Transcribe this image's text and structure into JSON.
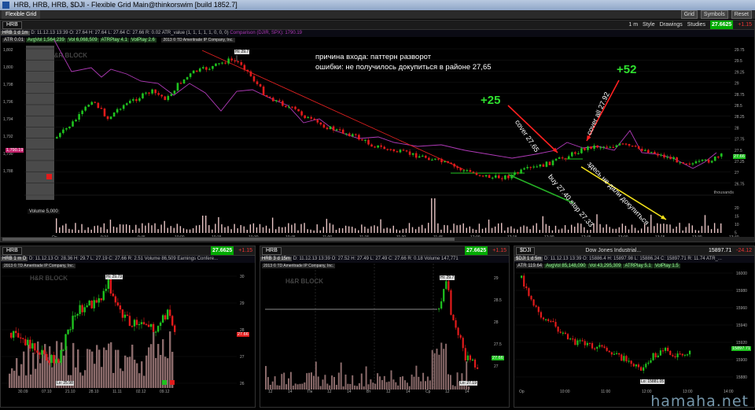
{
  "window": {
    "title": "HRB, HRB, HRB, $DJI - Flexible Grid Main@thinkorswim [build 1852.7]",
    "tab": "Flexible Grid",
    "buttons": [
      "Grid",
      "Symbols",
      "Reset"
    ]
  },
  "main": {
    "symbol": "HRB",
    "price": "27.6625",
    "change": "+1.15",
    "toolbar": [
      "Style",
      "Drawings",
      "Studies"
    ],
    "timeframe": "1 m",
    "info": "D: 11.12.13 13:39  O: 27.64  H: 27.64  L: 27.64  C: 27.66  R: 0.02  ATR_value (1, 1, 1, 1, 1, 0, 0, 0)",
    "info_label": "HRB 1 d 1m",
    "comparison": "Comparison (DJIR, SPX): 1790.19",
    "studies": [
      "ATR 0.01",
      "AvgVol 1,564,239",
      "Vol 6,068,509",
      "ATRPlay 4.1",
      "VolPlay 2.6"
    ],
    "copyright": "2013 © TD Ameritrade IP Company, Inc.",
    "company": "H&R BLOCK",
    "hi_label": "Hi: 29.7",
    "last_tag": "27.66",
    "left_tag": "1,790.19",
    "right_axis": [
      "29.75",
      "29.5",
      "29.25",
      "29",
      "28.75",
      "28.5",
      "28.25",
      "28",
      "27.75",
      "27.5",
      "27.25",
      "27",
      "26.75"
    ],
    "left_axis": [
      "1,802",
      "1,800",
      "1,798",
      "1,796",
      "1,794",
      "1,792",
      "1,790",
      "1,788"
    ],
    "time_axis": [
      "Op",
      "9:34",
      "9:45",
      "10:00",
      "10:15",
      "10:30",
      "10:45",
      "11:00",
      "11:15",
      "11:30",
      "11:45",
      "12:00",
      "12:15",
      "12:30",
      "12:45",
      "13:00",
      "13:15",
      "13:30",
      "13:40"
    ],
    "volume_label": "Volume  5,000",
    "volume_unit": "thousands",
    "volume_axis": [
      "20",
      "15",
      "10",
      "5"
    ],
    "annotation_line1": "причина входа: паттерн разворот",
    "annotation_line2": "ошибки: не получилось докупиться в районе 27,65",
    "plus25": "+25",
    "plus52": "+52",
    "cover1": "cover 27.65",
    "cover2": "cover all 27.92",
    "buy": "buy 27.40 stop 27.33",
    "nodocup": "здесь не дали докупиться"
  },
  "panel1": {
    "symbol": "HRB",
    "price": "27.6625",
    "change": "+1.15",
    "info": "D: 11.12.13  O: 28.36  H: 29.7  L: 27.19  C: 27.66  R: 2.51  Volume 86,509  Earnings Confere...",
    "info_label": "HRB 1 m D",
    "copyright": "2013 © TD Ameritrade IP Company, Inc.",
    "company": "H&R BLOCK",
    "hi_label": "Hi: 29.73",
    "lo_label": "Lo: 25.98",
    "last_tag": "27.66",
    "right_axis": [
      "30",
      "29",
      "28",
      "27",
      "26"
    ],
    "time_axis": [
      "30.09",
      "07.10",
      "21.10",
      "28.10",
      "11.11",
      "02.12",
      "09.12"
    ]
  },
  "panel2": {
    "symbol": "HRB",
    "price": "27.6625",
    "change": "+1.15",
    "info": "D: 11.12.13 13:39  O: 27.52  H: 27.49  L: 27.49  C: 27.66  R: 0.18  Volume 147,771",
    "info_label": "HRB 3 d 15m",
    "copyright": "2013 © TD Ameritrade IP Company, Inc.",
    "company": "H&R BLOCK",
    "hi_label": "Hi: 29.7",
    "lo_label": "Lo: 27.19",
    "last_tag": "27.66",
    "right_axis": [
      "29",
      "28.5",
      "28",
      "27.5",
      "27"
    ],
    "time_axis": [
      "12",
      "14",
      "Пн",
      "12",
      "14",
      "Вт",
      "12",
      "14",
      "Ср",
      "12",
      "14"
    ]
  },
  "panel3": {
    "symbol": "$DJI",
    "price": "15897.71",
    "change": "-24.12",
    "name": "Dow Jones Industrial...",
    "info": "D: 11.12.13 13:39  O: 15886.4  H: 15897.98  L: 15886.24  C: 15897.71  R: 11.74  ATR_...",
    "info_label": "$DJI 1 d 5m",
    "studies": [
      "ATR 119.64",
      "AvgVol 85,148,090",
      "Vol 43,295,309",
      "ATRPlay 5.1",
      "VolPlay 1.5"
    ],
    "last_tag": "15897.71",
    "lo_label": "Lo: 15881.05",
    "right_axis": [
      "16000",
      "15980",
      "15960",
      "15940",
      "15920",
      "15900",
      "15880"
    ],
    "time_axis": [
      "Op",
      "10:00",
      "11:00",
      "12:00",
      "13:00",
      "14:00"
    ]
  },
  "site": "hamaha.net",
  "colors": {
    "up": "#1fc21f",
    "down": "#e21b1b",
    "comparison": "#b03ab8",
    "trend": "#e02020",
    "support": "#1fc21f",
    "arrow_red": "#ff2020",
    "arrow_yellow": "#f2e11a",
    "arrow_green": "#26b026",
    "volume": "#e8c4c4"
  }
}
